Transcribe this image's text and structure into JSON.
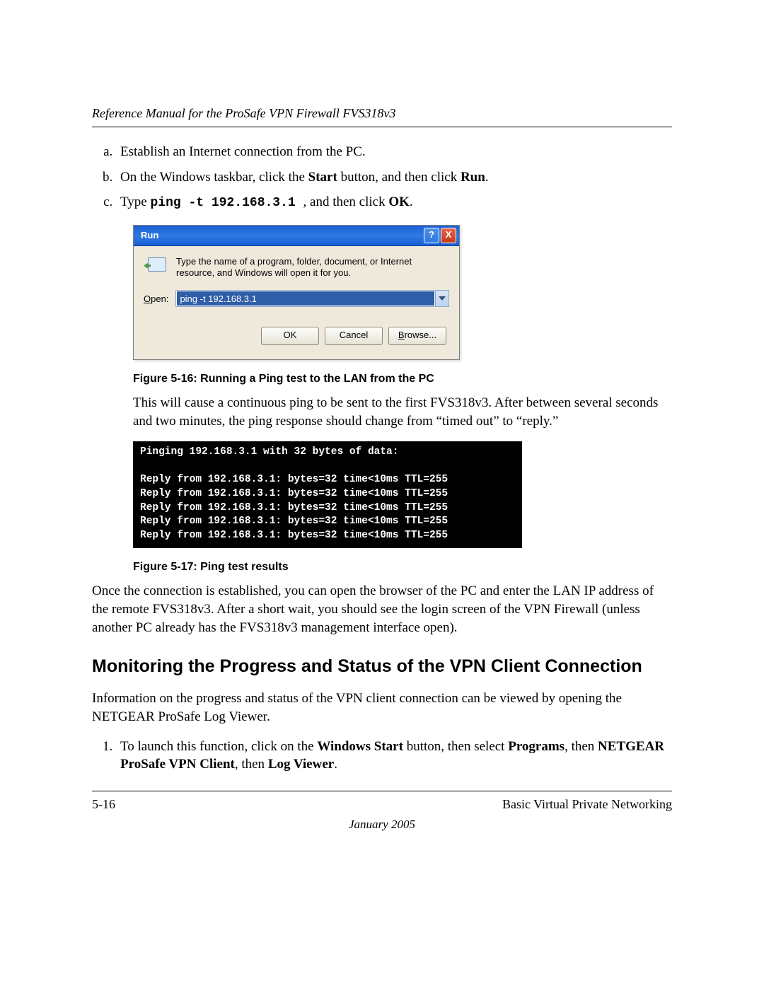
{
  "header": {
    "title": "Reference Manual for the ProSafe VPN Firewall FVS318v3"
  },
  "steps": {
    "a": "Establish an Internet connection from the PC.",
    "b_pre": "On the Windows taskbar, click the ",
    "b_bold1": "Start",
    "b_mid": " button, and then click ",
    "b_bold2": "Run",
    "b_post": ".",
    "c_pre": "Type ",
    "c_code": "ping -t 192.168.3.1 ",
    "c_mid": ", and then click ",
    "c_bold": "OK",
    "c_post": "."
  },
  "run_dialog": {
    "title": "Run",
    "description": "Type the name of a program, folder, document, or Internet resource, and Windows will open it for you.",
    "open_label": "Open:",
    "open_value": "ping -t 192.168.3.1",
    "buttons": {
      "ok": "OK",
      "cancel": "Cancel",
      "browse": "Browse..."
    }
  },
  "fig16_caption": "Figure 5-16:  Running a Ping test to the LAN from the PC",
  "para_after_fig16": "This will cause a continuous ping to be sent to the first FVS318v3. After between several seconds and two minutes, the ping response should change from “timed out” to “reply.”",
  "terminal_lines": [
    "Pinging 192.168.3.1 with 32 bytes of data:",
    "",
    "Reply from 192.168.3.1: bytes=32 time<10ms TTL=255",
    "Reply from 192.168.3.1: bytes=32 time<10ms TTL=255",
    "Reply from 192.168.3.1: bytes=32 time<10ms TTL=255",
    "Reply from 192.168.3.1: bytes=32 time<10ms TTL=255",
    "Reply from 192.168.3.1: bytes=32 time<10ms TTL=255"
  ],
  "fig17_caption": "Figure 5-17:  Ping test results",
  "para_after_fig17": "Once the connection is established, you can open the browser of the PC and enter the LAN IP address of the remote FVS318v3. After a short wait, you should see the login screen of the VPN Firewall (unless another PC already has the FVS318v3 management interface open).",
  "section_heading": "Monitoring the Progress and Status of the VPN Client Connection",
  "para_monitoring": "Information on the progress and status of the VPN client connection can be viewed by opening the NETGEAR ProSafe Log Viewer.",
  "step1": {
    "pre": "To launch this function, click on the ",
    "b1": "Windows Start",
    "mid1": " button, then select ",
    "b2": "Programs",
    "mid2": ", then ",
    "b3": "NETGEAR ProSafe VPN Client",
    "mid3": ", then ",
    "b4": "Log Viewer",
    "post": "."
  },
  "footer": {
    "page_num": "5-16",
    "section": "Basic Virtual Private Networking",
    "date": "January 2005"
  }
}
